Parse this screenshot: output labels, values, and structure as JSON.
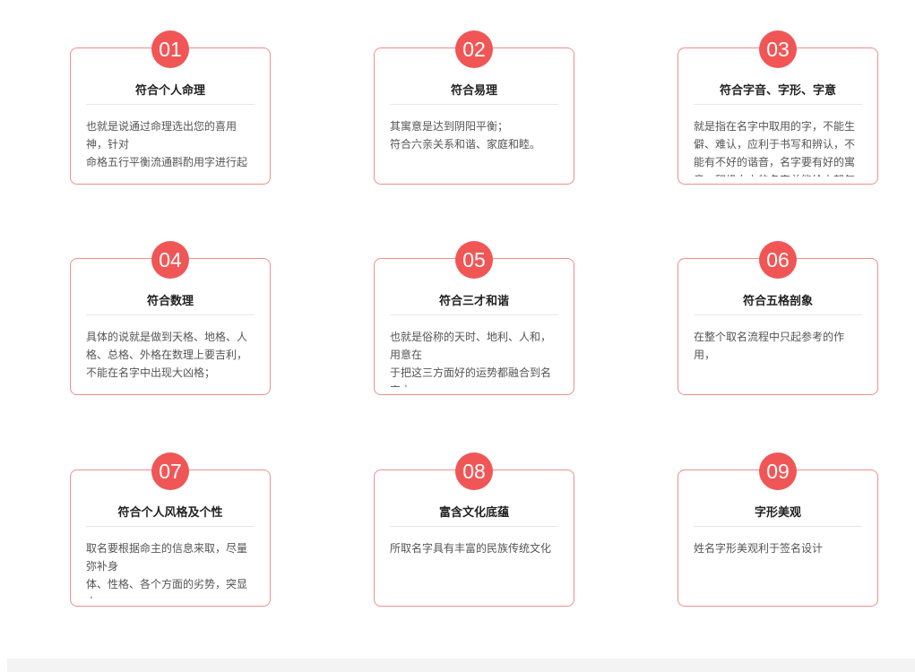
{
  "cards": [
    {
      "number": "01",
      "title": "符合个人命理",
      "description": "也就是说通过命理选出您的喜用神，针对\n命格五行平衡流通斟酌用字进行起"
    },
    {
      "number": "02",
      "title": "符合易理",
      "description": "其寓意是达到阴阳平衡；\n符合六亲关系和谐、家庭和睦。"
    },
    {
      "number": "03",
      "title": "符合字音、字形、字意",
      "description": "就是指在名字中取用的字，不能生僻、难认，应利于书写和辨认，不能有不好的谐音，名字要有好的寓意，积极向上的名字总能给人朝气"
    },
    {
      "number": "04",
      "title": "符合数理",
      "description": "具体的说就是做到天格、地格、人格、总格、外格在数理上要吉利，不能在名字中出现大凶格；"
    },
    {
      "number": "05",
      "title": "符合三才和谐",
      "description": "也就是俗称的天时、地利、人和，用意在\n于把这三方面好的运势都融合到名字中"
    },
    {
      "number": "06",
      "title": "符合五格剖象",
      "description": "在整个取名流程中只起参考的作用，"
    },
    {
      "number": "07",
      "title": "符合个人风格及个性",
      "description": "取名要根据命主的信息来取，尽量弥补身\n体、性格、各个方面的劣势，突显本"
    },
    {
      "number": "08",
      "title": "富含文化底蕴",
      "description": "所取名字具有丰富的民族传统文化"
    },
    {
      "number": "09",
      "title": "字形美观",
      "description": "姓名字形美观利于签名设计"
    }
  ]
}
